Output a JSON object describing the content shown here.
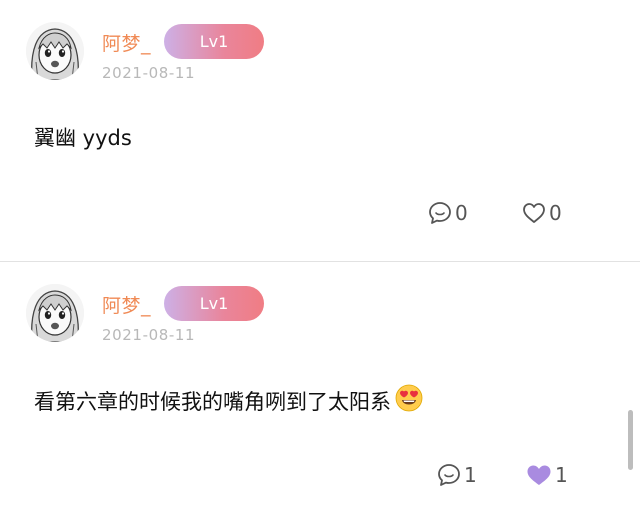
{
  "posts": [
    {
      "username": "阿梦_",
      "level": "Lv1",
      "date": "2021-08-11",
      "content": "翼幽 yyds",
      "emoji": "",
      "comment_count": "0",
      "like_count": "0",
      "liked": false
    },
    {
      "username": "阿梦_",
      "level": "Lv1",
      "date": "2021-08-11",
      "content": "看第六章的时候我的嘴角咧到了太阳系",
      "emoji": "heart-eyes-emoji",
      "comment_count": "1",
      "like_count": "1",
      "liked": true
    }
  ],
  "colors": {
    "username": "#f08a55",
    "badge_gradient": [
      "#cdb0e6",
      "#f07d84"
    ],
    "liked_heart": "#a98be0",
    "date": "#b8b8b8"
  },
  "icons": [
    "avatar-image",
    "comment-icon",
    "heart-outline-icon",
    "heart-filled-icon",
    "heart-eyes-emoji"
  ]
}
